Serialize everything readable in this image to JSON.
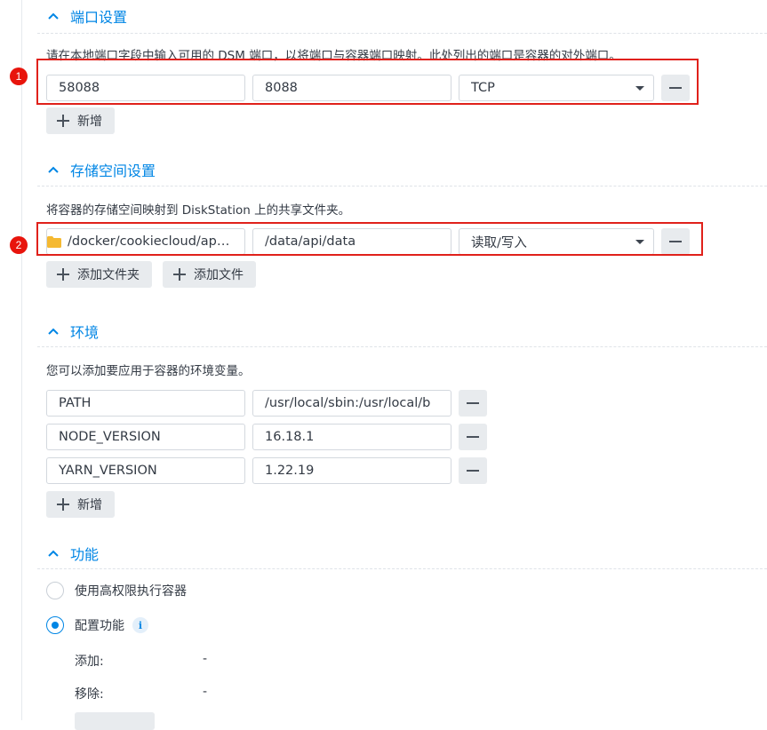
{
  "ports": {
    "title": "端口设置",
    "description": "请在本地端口字段中输入可用的 DSM 端口，以将端口与容器端口映射。此处列出的端口是容器的对外端口。",
    "rows": [
      {
        "local_port": "58088",
        "container_port": "8088",
        "protocol": "TCP"
      }
    ],
    "add_label": "新增"
  },
  "storage": {
    "title": "存储空间设置",
    "description": "将容器的存储空间映射到 DiskStation 上的共享文件夹。",
    "rows": [
      {
        "host_path": "/docker/cookiecloud/apid...",
        "mount_path": "/data/api/data",
        "permission": "读取/写入"
      }
    ],
    "add_folder_label": "添加文件夹",
    "add_file_label": "添加文件"
  },
  "environment": {
    "title": "环境",
    "description": "您可以添加要应用于容器的环境变量。",
    "rows": [
      {
        "key": "PATH",
        "value": "/usr/local/sbin:/usr/local/b"
      },
      {
        "key": "NODE_VERSION",
        "value": "16.18.1"
      },
      {
        "key": "YARN_VERSION",
        "value": "1.22.19"
      }
    ],
    "add_label": "新增"
  },
  "capabilities": {
    "title": "功能",
    "option_privileged": "使用高权限执行容器",
    "option_configure": "配置功能",
    "info_symbol": "i",
    "add_label": "添加:",
    "add_value": "-",
    "remove_label": "移除:",
    "remove_value": "-"
  },
  "annotations": {
    "badge1": "1",
    "badge2": "2"
  },
  "colors": {
    "accent": "#0086e5",
    "highlight": "#e0211b",
    "button_bg": "#e8ebee"
  }
}
